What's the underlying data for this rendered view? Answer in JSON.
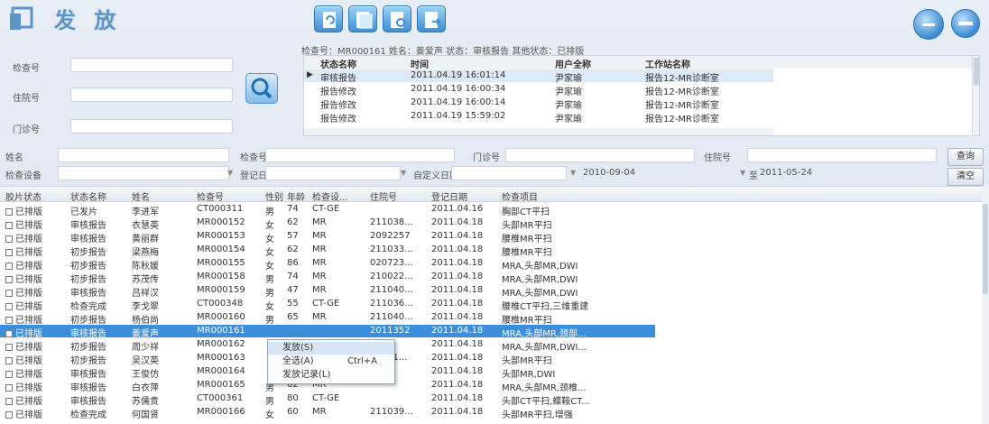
{
  "header": {
    "title": "发 放",
    "toolbar_icons": [
      "refresh-doc-icon",
      "document-icon",
      "document-search-icon",
      "document-export-icon"
    ],
    "right_icons": [
      "minimize-circle-icon",
      "close-circle-icon"
    ]
  },
  "query": {
    "exam_no_label": "检查号",
    "inpatient_no_label": "住院号",
    "outpatient_no_label": "门诊号"
  },
  "status_panel": {
    "header_text": "检查号：MR000161 姓名：姜爱声 状态：审核报告 其他状态：已排版",
    "columns": [
      "状态名称",
      "时间",
      "用户全称",
      "工作站名称"
    ],
    "rows": [
      [
        "审核报告",
        "2011.04.19 16:01:14",
        "尹家瑜",
        "报告12-MR诊断室"
      ],
      [
        "报告修改",
        "2011.04.19 16:00:34",
        "尹家瑜",
        "报告12-MR诊断室"
      ],
      [
        "报告修改",
        "2011.04.19 16:00:14",
        "尹家瑜",
        "报告12-MR诊断室"
      ],
      [
        "报告修改",
        "2011.04.19 15:59:02",
        "尹家瑜",
        "报告12-MR诊断室"
      ]
    ]
  },
  "filters": {
    "name_label": "姓名",
    "exam_no_label": "检查号",
    "outpatient_no_label": "门诊号",
    "inpatient_no_label": "住院号",
    "device_label": "检查设备",
    "reg_date_label": "登记日期",
    "custom_date_label": "自定义日期",
    "date_from": "2010-09-04",
    "date_to_prefix": "至",
    "date_to": "2011-05-24",
    "query_button": "查询",
    "clear_button": "清空"
  },
  "grid": {
    "columns": [
      "胶片状态",
      "状态名称",
      "姓名",
      "检查号",
      "性别",
      "年龄",
      "检查设...",
      "住院号",
      "登记日期",
      "检查项目"
    ],
    "rows": [
      [
        "已排版",
        "已发片",
        "李进军",
        "CT000311",
        "男",
        "74",
        "CT-GE",
        "",
        "2011.04.16",
        "胸部CT平扫"
      ],
      [
        "已排版",
        "审核报告",
        "衣慧英",
        "MR000152",
        "女",
        "62",
        "MR",
        "211038...",
        "2011.04.18",
        "头部MR平扫"
      ],
      [
        "已排版",
        "审核报告",
        "黄丽群",
        "MR000153",
        "女",
        "57",
        "MR",
        "2092257",
        "2011.04.18",
        "腰椎MR平扫"
      ],
      [
        "已排版",
        "初步报告",
        "梁燕梅",
        "MR000154",
        "女",
        "62",
        "MR",
        "211033...",
        "2011.04.18",
        "腰椎MR平扫"
      ],
      [
        "已排版",
        "初步报告",
        "陈秋媛",
        "MR000155",
        "女",
        "86",
        "MR",
        "020723...",
        "2011.04.18",
        "MRA,头部MR,DWI"
      ],
      [
        "已排版",
        "初步报告",
        "苏茂传",
        "MR000158",
        "男",
        "74",
        "MR",
        "210022...",
        "2011.04.18",
        "MRA,头部MR,DWI"
      ],
      [
        "已排版",
        "审核报告",
        "吕祥汉",
        "MR000159",
        "男",
        "47",
        "MR",
        "211040...",
        "2011.04.18",
        "MRA,头部MR,DWI"
      ],
      [
        "已排版",
        "检查完成",
        "李戈翠",
        "CT000348",
        "女",
        "55",
        "CT-GE",
        "211036...",
        "2011.04.18",
        "腰椎CT平扫,三维重建"
      ],
      [
        "已排版",
        "初步报告",
        "杨伯尚",
        "MR000160",
        "男",
        "65",
        "MR",
        "211040...",
        "2011.04.18",
        "腰椎MR平扫"
      ],
      [
        "已排版",
        "审核报告",
        "姜爱声",
        "MR000161",
        "",
        "",
        "",
        "2011352",
        "2011.04.18",
        "MRA,头部MR,颈部..."
      ],
      [
        "已排版",
        "初步报告",
        "周少祥",
        "MR000162",
        "",
        "",
        "",
        "",
        "2011.04.18",
        "MRA,头部MR,DWI..."
      ],
      [
        "已排版",
        "初步报告",
        "吴汉英",
        "MR000163",
        "",
        "",
        "",
        "11041...",
        "2011.04.18",
        "头部MR平扫"
      ],
      [
        "已排版",
        "审核报告",
        "王俊仿",
        "MR000164",
        "",
        "",
        "",
        "",
        "2011.04.18",
        "头部MR,DWI"
      ],
      [
        "已排版",
        "审核报告",
        "白衣萍",
        "MR000165",
        "男",
        "62",
        "MR",
        "",
        "2011.04.18",
        "MRA,头部MR,颈椎..."
      ],
      [
        "已排版",
        "审核报告",
        "苏儒贵",
        "CT000361",
        "男",
        "80",
        "CT-GE",
        "",
        "2011.04.18",
        "头部CT平扫,蝶鞍CT..."
      ],
      [
        "已排版",
        "检查完成",
        "何国贤",
        "MR000166",
        "女",
        "60",
        "MR",
        "211039...",
        "2011.04.18",
        "头部MR平扫,增强"
      ]
    ],
    "selected_index": 9
  },
  "context_menu": {
    "issue": "发放(S)",
    "select_all": "全选(A)",
    "select_all_shortcut": "Ctrl+A",
    "issue_log": "发放记录(L)"
  },
  "colors": {
    "selection": "#3a8edb",
    "title": "#5d95c9",
    "accent": "#3d8fd3"
  }
}
